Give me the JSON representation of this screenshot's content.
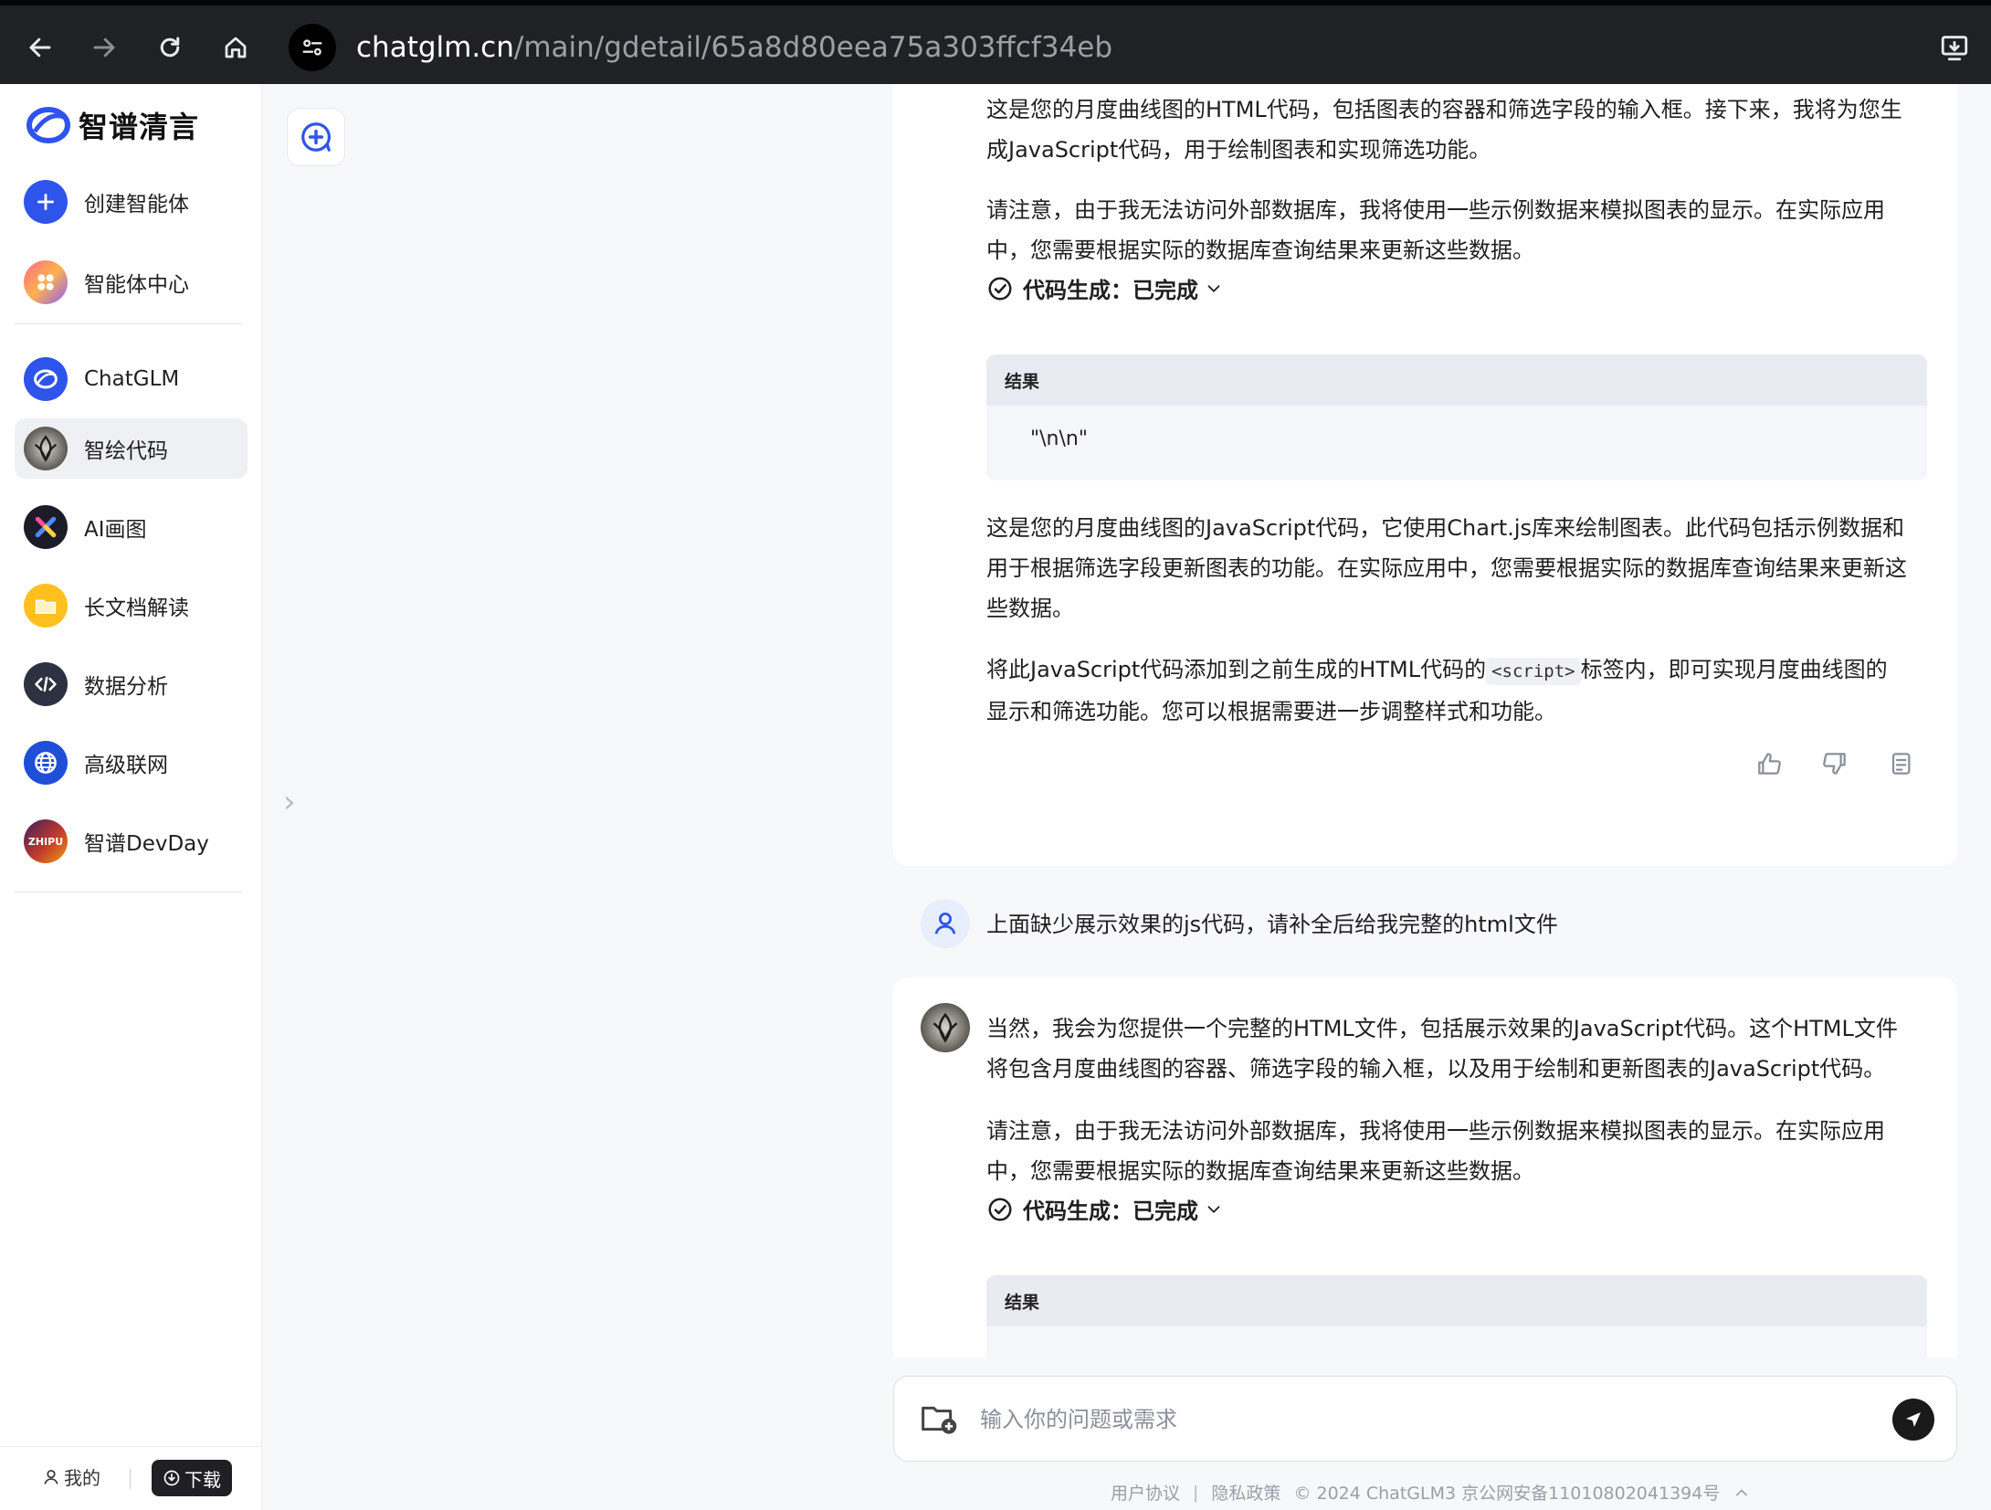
{
  "browser": {
    "url_host": "chatglm.cn",
    "url_path": "/main/gdetail/65a8d80eea75a303ffcf34eb"
  },
  "sidebar": {
    "logo_text": "智谱清言",
    "items": [
      {
        "label": "创建智能体"
      },
      {
        "label": "智能体中心"
      },
      {
        "label": "ChatGLM"
      },
      {
        "label": "智绘代码"
      },
      {
        "label": "AI画图"
      },
      {
        "label": "长文档解读"
      },
      {
        "label": "数据分析"
      },
      {
        "label": "高级联网"
      },
      {
        "label": "智谱DevDay"
      }
    ],
    "me_label": "我的",
    "download_label": "下载",
    "devday_badge": "ZHIPU"
  },
  "chat": {
    "msg1": {
      "para1": "这是您的月度曲线图的HTML代码，包括图表的容器和筛选字段的输入框。接下来，我将为您生成JavaScript代码，用于绘制图表和实现筛选功能。",
      "para2": "请注意，由于我无法访问外部数据库，我将使用一些示例数据来模拟图表的显示。在实际应用中，您需要根据实际的数据库查询结果来更新这些数据。",
      "status": "代码生成：已完成",
      "result_title": "结果",
      "result_value": "\"\\n\\n\"",
      "para3": "这是您的月度曲线图的JavaScript代码，它使用Chart.js库来绘制图表。此代码包括示例数据和用于根据筛选字段更新图表的功能。在实际应用中，您需要根据实际的数据库查询结果来更新这些数据。",
      "para4_before": "将此JavaScript代码添加到之前生成的HTML代码的",
      "para4_code": "<script>",
      "para4_after": "标签内，即可实现月度曲线图的显示和筛选功能。您可以根据需要进一步调整样式和功能。"
    },
    "user_msg": "上面缺少展示效果的js代码，请补全后给我完整的html文件",
    "msg2": {
      "para1": "当然，我会为您提供一个完整的HTML文件，包括展示效果的JavaScript代码。这个HTML文件将包含月度曲线图的容器、筛选字段的输入框，以及用于绘制和更新图表的JavaScript代码。",
      "para2": "请注意，由于我无法访问外部数据库，我将使用一些示例数据来模拟图表的显示。在实际应用中，您需要根据实际的数据库查询结果来更新这些数据。",
      "status": "代码生成：已完成",
      "result_title": "结果"
    }
  },
  "input": {
    "placeholder": "输入你的问题或需求"
  },
  "footer": {
    "terms": "用户协议",
    "privacy": "隐私政策",
    "copyright": "© 2024 ChatGLM3 京公网安备11010802041394号"
  },
  "colors": {
    "brand_blue": "#3b5bff",
    "dark": "#1f1f24"
  }
}
